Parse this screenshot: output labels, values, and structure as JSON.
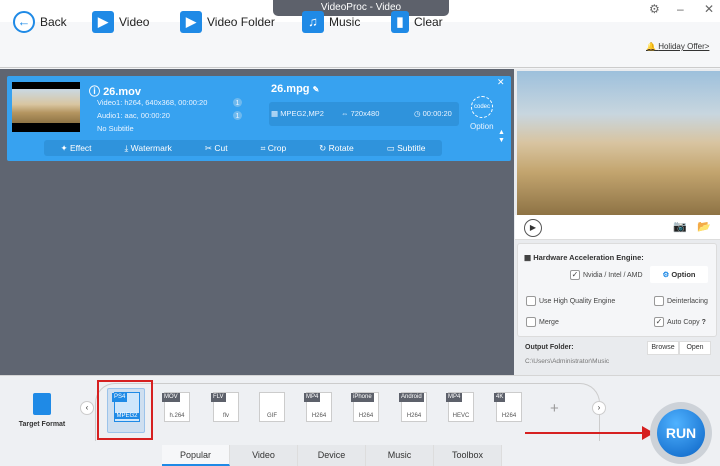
{
  "window": {
    "title": "VideoProc - Video"
  },
  "toolbar": {
    "back": "Back",
    "video": "Video",
    "video_folder": "Video Folder",
    "music": "Music",
    "clear": "Clear",
    "offer": "Holiday Offer>"
  },
  "task": {
    "source_name": "26.mov",
    "video_info": "Video1: h264, 640x368, 00:00:20",
    "audio_info": "Audio1: aac, 00:00:20",
    "subtitle_info": "No Subtitle",
    "track_count_video": "1",
    "track_count_audio": "1",
    "output_name": "26.mpg",
    "codec": "MPEG2,MP2",
    "resolution": "720x480",
    "duration": "00:00:20",
    "option": "Option",
    "codec_badge": "codec",
    "actions": [
      "Effect",
      "Watermark",
      "Cut",
      "Crop",
      "Rotate",
      "Subtitle"
    ]
  },
  "settings": {
    "hw_title": "Hardware Acceleration Engine:",
    "hw_option": "Nvidia / Intel / AMD",
    "option_btn": "Option",
    "high_quality": "Use High Quality Engine",
    "deinterlacing": "Deinterlacing",
    "merge": "Merge",
    "auto_copy": "Auto Copy",
    "help": "?",
    "output_folder_label": "Output Folder:",
    "browse": "Browse",
    "open": "Open",
    "output_path": "C:\\Users\\Administrator\\Music"
  },
  "bottom": {
    "target_format": "Target Format",
    "formats": [
      {
        "tag": "PS4",
        "sub": "MPEG2"
      },
      {
        "tag": "MOV",
        "sub": "h.264"
      },
      {
        "tag": "FLV",
        "sub": "flv"
      },
      {
        "tag": "",
        "sub": "GIF"
      },
      {
        "tag": "MP4",
        "sub": "H264"
      },
      {
        "tag": "iPhone",
        "sub": "H264"
      },
      {
        "tag": "Android",
        "sub": "H264"
      },
      {
        "tag": "MP4",
        "sub": "HEVC"
      },
      {
        "tag": "4K",
        "sub": "H264"
      }
    ],
    "tabs": [
      "Popular",
      "Video",
      "Device",
      "Music",
      "Toolbox"
    ],
    "run": "RUN"
  },
  "colors": {
    "accent": "#1f8ae6",
    "card": "#37a2f0",
    "highlight": "#d62020"
  }
}
